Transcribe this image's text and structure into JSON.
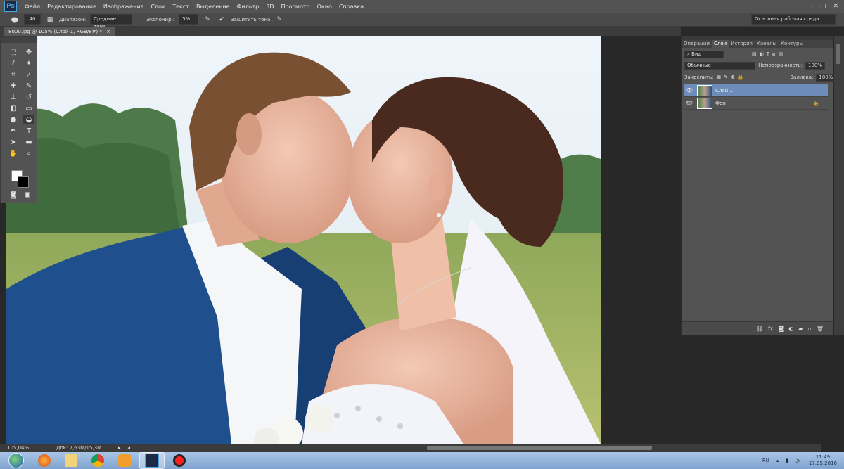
{
  "app": {
    "logo": "Ps"
  },
  "menu": [
    "Файл",
    "Редактирование",
    "Изображение",
    "Слои",
    "Текст",
    "Выделение",
    "Фильтр",
    "3D",
    "Просмотр",
    "Окно",
    "Справка"
  ],
  "window_controls": {
    "minimize": "–",
    "maximize": "□",
    "close": "✕"
  },
  "options": {
    "brush_size": "40",
    "range_label": "Диапазон:",
    "range_value": "Средние тона",
    "exposure_label": "Экспонир.:",
    "exposure_value": "5%",
    "protect_label": "Защитить тона",
    "workspace": "Основная рабочая среда"
  },
  "document": {
    "tab_title": "8000.jpg @ 105% (Слой 1, RGB/8#) *",
    "close": "×"
  },
  "status": {
    "zoom": "105,04%",
    "doc_size": "Док: 7,63M/15,3M"
  },
  "layers_panel": {
    "tabs": [
      "Операции",
      "Слои",
      "История",
      "Каналы",
      "Контуры"
    ],
    "active_tab": "Слои",
    "kind_label": "Вид",
    "blend_mode": "Обычные",
    "opacity_label": "Непрозрачность:",
    "opacity_value": "100%",
    "lock_label": "Закрепить:",
    "fill_label": "Заливка:",
    "fill_value": "100%",
    "layers": [
      {
        "name": "Слой 1",
        "active": true,
        "locked": false
      },
      {
        "name": "Фон",
        "active": false,
        "locked": true
      }
    ],
    "footer_icons": [
      "link-icon",
      "fx-icon",
      "mask-icon",
      "adjustment-icon",
      "folder-icon",
      "new-layer-icon",
      "trash-icon"
    ]
  },
  "taskbar": {
    "apps": [
      "firefox-icon",
      "explorer-icon",
      "chrome-icon",
      "media-player-icon",
      "photoshop-icon",
      "record-icon"
    ],
    "language": "RU",
    "time": "11:49",
    "date": "17.05.2016"
  }
}
